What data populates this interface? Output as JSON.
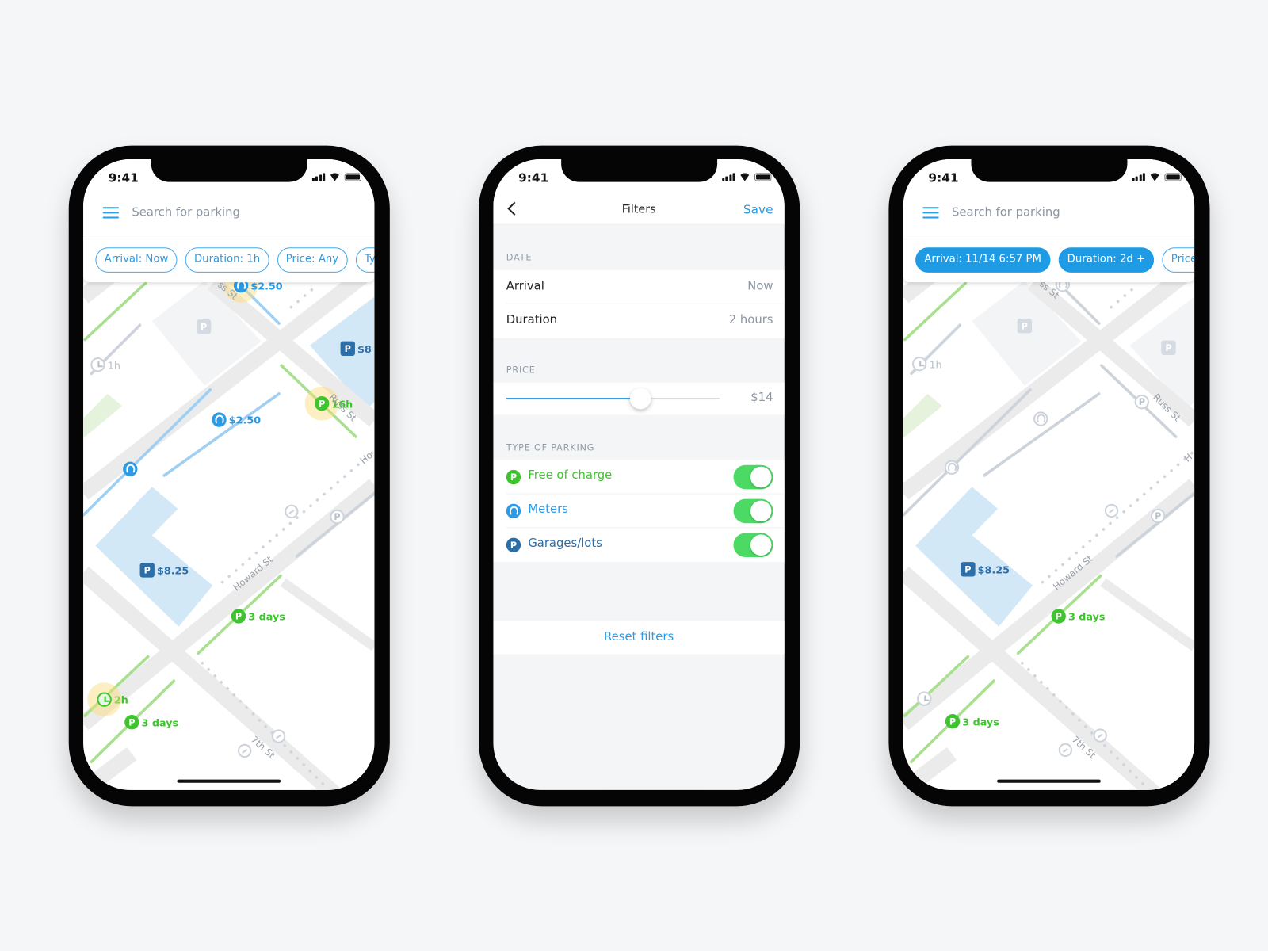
{
  "colors": {
    "accent": "#2b9be6",
    "free": "#3ec52e",
    "garage": "#2b6ea8",
    "toggle_on": "#4cd964",
    "background": "#f5f6f8"
  },
  "status": {
    "time": "9:41"
  },
  "map_screen_1": {
    "search_placeholder": "Search for parking",
    "menu_icon": "hamburger-icon",
    "chips": [
      "Arrival: Now",
      "Duration: 1h",
      "Price: Any",
      "Typ"
    ],
    "markers": {
      "meter_top": "$2.50",
      "garage_right": "$8",
      "free_16h": "16h",
      "meter_mid": "$2.50",
      "garage_825": "$8.25",
      "free_3days_a": "3 days",
      "clock_2h": "2h",
      "free_3days_b": "3 days",
      "clock_1h": "1h"
    },
    "streets": {
      "russ_top": "ss St",
      "russ": "Russ St",
      "howard": "Howard St",
      "seventh": "7th St",
      "howard_edge": "Ho"
    }
  },
  "filters_screen": {
    "title": "Filters",
    "save_label": "Save",
    "date_section": "DATE",
    "arrival_label": "Arrival",
    "arrival_value": "Now",
    "duration_label": "Duration",
    "duration_value": "2 hours",
    "price_section": "PRICE",
    "price_value": "$14",
    "price_slider_fraction": 0.63,
    "type_section": "TYPE OF PARKING",
    "types": [
      {
        "label": "Free of charge",
        "enabled": true,
        "icon": "free-parking-icon"
      },
      {
        "label": "Meters",
        "enabled": true,
        "icon": "meter-icon"
      },
      {
        "label": "Garages/lots",
        "enabled": true,
        "icon": "garage-icon"
      }
    ],
    "reset_label": "Reset filters"
  },
  "map_screen_2": {
    "search_placeholder": "Search for parking",
    "chips": [
      "Arrival: 11/14 6:57 PM",
      "Duration: 2d +",
      "Price: A"
    ],
    "markers": {
      "clock_1h": "1h",
      "garage_825": "$8.25",
      "free_3days_a": "3 days",
      "free_3days_b": "3 days"
    },
    "streets": {
      "russ_top": "ss St",
      "russ": "Russ St",
      "howard": "Howard St",
      "seventh": "7th St",
      "howard_edge": "H"
    }
  }
}
